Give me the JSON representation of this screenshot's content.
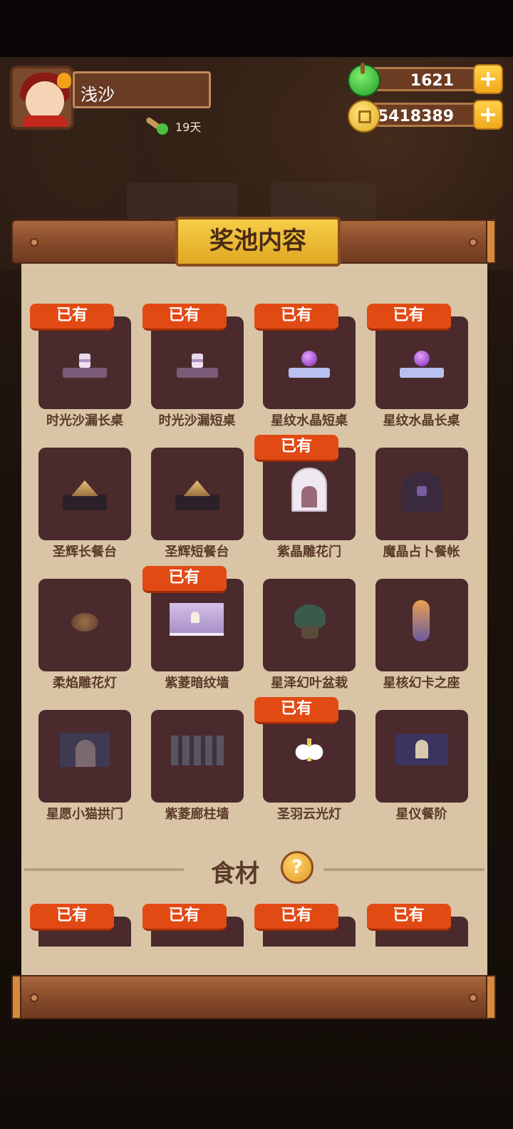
{
  "player": {
    "name": "浅沙",
    "days": "19天"
  },
  "currencies": {
    "gems": {
      "value": "1621",
      "plus": "+"
    },
    "coins": {
      "value": "5418389",
      "plus": "+"
    }
  },
  "panel": {
    "title": "奖池内容",
    "owned_badge": "已有"
  },
  "items": [
    {
      "name": "时光沙漏长桌",
      "owned": true,
      "icon": "hourglass-long-table"
    },
    {
      "name": "时光沙漏短桌",
      "owned": true,
      "icon": "hourglass-short-table"
    },
    {
      "name": "星纹水晶短桌",
      "owned": true,
      "icon": "crystal-short-table"
    },
    {
      "name": "星纹水晶长桌",
      "owned": true,
      "icon": "crystal-long-table"
    },
    {
      "name": "圣辉长餐台",
      "owned": false,
      "icon": "long-banquet-table"
    },
    {
      "name": "圣辉短餐台",
      "owned": false,
      "icon": "short-banquet-table"
    },
    {
      "name": "紫晶雕花门",
      "owned": true,
      "icon": "carved-door"
    },
    {
      "name": "魔晶占卜餐帐",
      "owned": false,
      "icon": "divination-tent"
    },
    {
      "name": "柔焰雕花灯",
      "owned": false,
      "icon": "carved-lamp"
    },
    {
      "name": "紫菱暗纹墙",
      "owned": true,
      "icon": "purple-wall"
    },
    {
      "name": "星泽幻叶盆栽",
      "owned": false,
      "icon": "potted-plant"
    },
    {
      "name": "星核幻卡之座",
      "owned": false,
      "icon": "card-seat"
    },
    {
      "name": "星愿小猫拱门",
      "owned": false,
      "icon": "cat-archway"
    },
    {
      "name": "紫菱廊柱墙",
      "owned": false,
      "icon": "column-wall"
    },
    {
      "name": "圣羽云光灯",
      "owned": true,
      "icon": "cloud-lamp"
    },
    {
      "name": "星仪餐阶",
      "owned": false,
      "icon": "dining-stage"
    }
  ],
  "food": {
    "title": "食材",
    "help": "?",
    "items": [
      {
        "owned": true
      },
      {
        "owned": true
      },
      {
        "owned": true
      },
      {
        "owned": true
      }
    ]
  },
  "colors": {
    "badge": "#e24a14",
    "tile": "#4a2a2c",
    "paper": "#d9c4a6",
    "gold": "#f6cd48"
  }
}
